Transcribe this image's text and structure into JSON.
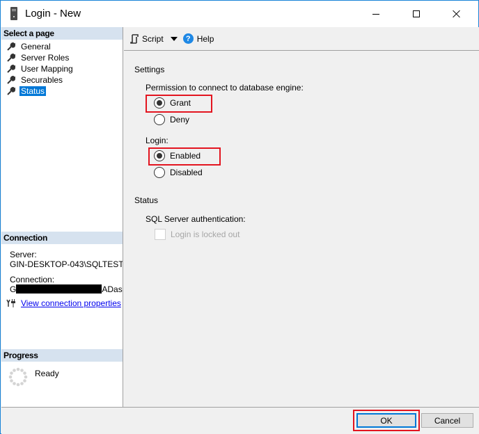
{
  "window": {
    "title": "Login - New",
    "controls": {
      "minimize": "minimize",
      "maximize": "maximize",
      "close": "close"
    }
  },
  "sidebar": {
    "select_page_header": "Select a page",
    "pages": [
      {
        "label": "General",
        "icon": "wrench-icon",
        "selected": false
      },
      {
        "label": "Server Roles",
        "icon": "wrench-icon",
        "selected": false
      },
      {
        "label": "User Mapping",
        "icon": "wrench-icon",
        "selected": false
      },
      {
        "label": "Securables",
        "icon": "wrench-icon",
        "selected": false
      },
      {
        "label": "Status",
        "icon": "wrench-icon",
        "selected": true
      }
    ],
    "connection": {
      "header": "Connection",
      "server_label": "Server:",
      "server_value": "GIN-DESKTOP-043\\SQLTEST",
      "connection_label": "Connection:",
      "connection_prefix": "G",
      "connection_suffix": "ADas",
      "view_link": "View connection properties"
    },
    "progress": {
      "header": "Progress",
      "status": "Ready"
    }
  },
  "toolbar": {
    "script_label": "Script",
    "help_label": "Help"
  },
  "main": {
    "settings_header": "Settings",
    "permission_label": "Permission to connect to database engine:",
    "permission_options": [
      {
        "label": "Grant",
        "checked": true
      },
      {
        "label": "Deny",
        "checked": false
      }
    ],
    "login_label": "Login:",
    "login_options": [
      {
        "label": "Enabled",
        "checked": true
      },
      {
        "label": "Disabled",
        "checked": false
      }
    ],
    "status_header": "Status",
    "sql_auth_label": "SQL Server authentication:",
    "locked_out_label": "Login is locked out",
    "locked_out_checked": false,
    "locked_out_enabled": false
  },
  "footer": {
    "ok_label": "OK",
    "cancel_label": "Cancel"
  },
  "colors": {
    "highlight": "#e3141f",
    "selection": "#0078d7",
    "section_header": "#d6e2ef",
    "window_border": "#1883d7"
  }
}
